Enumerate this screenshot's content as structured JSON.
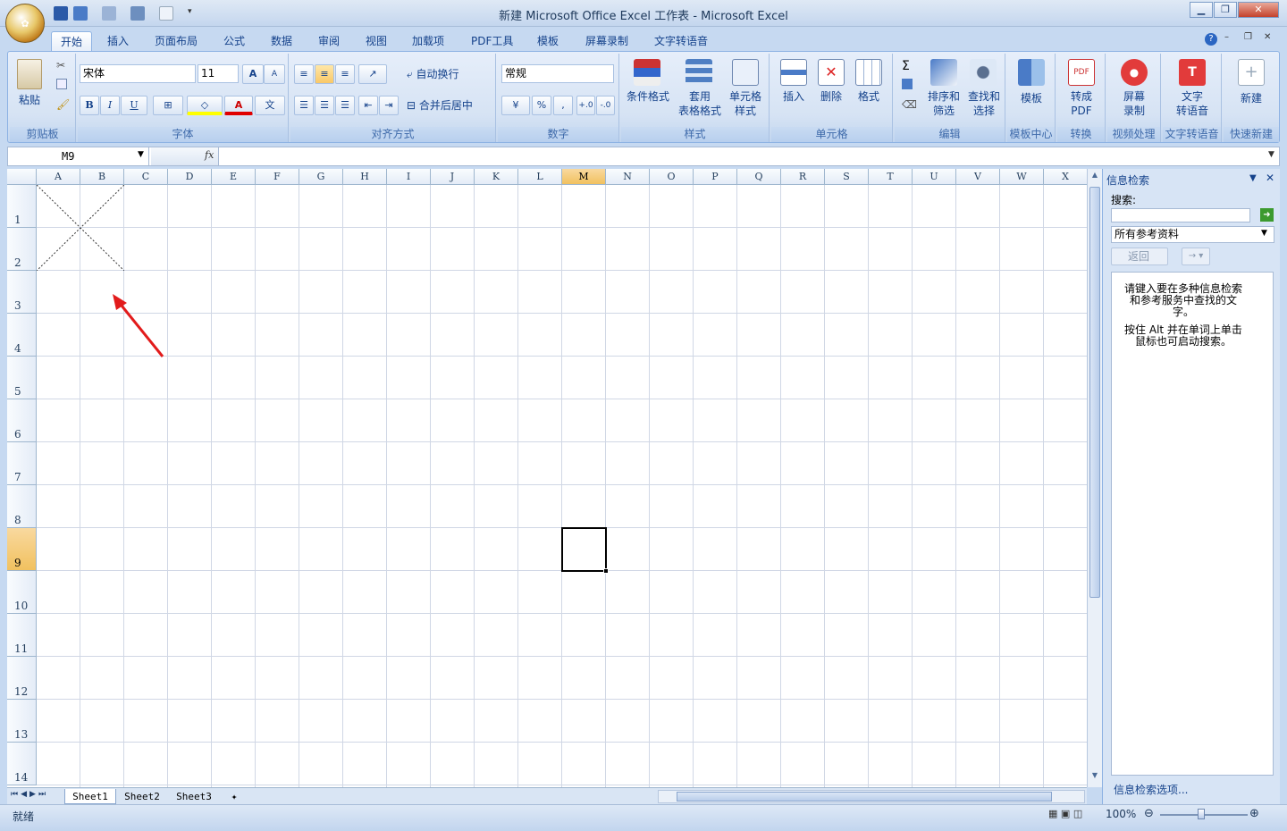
{
  "window": {
    "title": "新建 Microsoft Office Excel 工作表 - Microsoft Excel",
    "office_button": "Office"
  },
  "ribbon_tabs": [
    "开始",
    "插入",
    "页面布局",
    "公式",
    "数据",
    "审阅",
    "视图",
    "加载项",
    "PDF工具",
    "模板",
    "屏幕录制",
    "文字转语音"
  ],
  "clipboard": {
    "paste": "粘贴",
    "label": "剪贴板"
  },
  "font": {
    "name": "宋体",
    "size": "11",
    "grow": "A",
    "shrink": "A",
    "bold": "B",
    "italic": "I",
    "underline": "U",
    "label": "字体"
  },
  "alignment": {
    "wrap": "自动换行",
    "merge": "合并后居中",
    "label": "对齐方式"
  },
  "number": {
    "format": "常规",
    "percent": "%",
    "comma": ",",
    "inc": "+.0",
    "dec": "-.0",
    "label": "数字"
  },
  "styles": {
    "conditional": "条件格式",
    "table1": "套用",
    "table2": "表格格式",
    "cell1": "单元格",
    "cell2": "样式",
    "label": "样式"
  },
  "cells": {
    "insert": "插入",
    "delete": "删除",
    "format": "格式",
    "label": "单元格"
  },
  "editing": {
    "sigma": "Σ",
    "sort1": "排序和",
    "sort2": "筛选",
    "find1": "查找和",
    "find2": "选择",
    "label": "编辑"
  },
  "template_center": {
    "btn": "模板",
    "label": "模板中心"
  },
  "convert": {
    "btn1": "转成",
    "btn2": "PDF",
    "label": "转换"
  },
  "video": {
    "btn1": "屏幕",
    "btn2": "录制",
    "label": "视频处理"
  },
  "tts": {
    "btn1": "文字",
    "btn2": "转语音",
    "label": "文字转语音"
  },
  "quicknew": {
    "btn": "新建",
    "label": "快速新建"
  },
  "formula_bar": {
    "namebox": "M9",
    "fx": "fx",
    "value": ""
  },
  "columns": [
    "A",
    "B",
    "C",
    "D",
    "E",
    "F",
    "G",
    "H",
    "I",
    "J",
    "K",
    "L",
    "M",
    "N",
    "O",
    "P",
    "Q",
    "R",
    "S",
    "T",
    "U",
    "V",
    "W",
    "X"
  ],
  "rows": [
    "1",
    "2",
    "3",
    "4",
    "5",
    "6",
    "7",
    "8",
    "9",
    "10",
    "11",
    "12",
    "13",
    "14"
  ],
  "selected": {
    "col": "M",
    "row": "9"
  },
  "research_pane": {
    "title": "信息检索",
    "search_label": "搜索:",
    "search_value": "",
    "source": "所有参考资料",
    "back": "返回",
    "hint1": "请键入要在多种信息检索和参考服务中查找的文字。",
    "hint2": "按住 Alt 并在单词上单击鼠标也可启动搜索。",
    "footer": "信息检索选项..."
  },
  "sheets": [
    "Sheet1",
    "Sheet2",
    "Sheet3"
  ],
  "status": {
    "ready": "就绪",
    "zoom": "100%"
  },
  "colors": {
    "accent": "#15428b",
    "selection": "#f1c15f",
    "arrow": "#e21b1b"
  }
}
